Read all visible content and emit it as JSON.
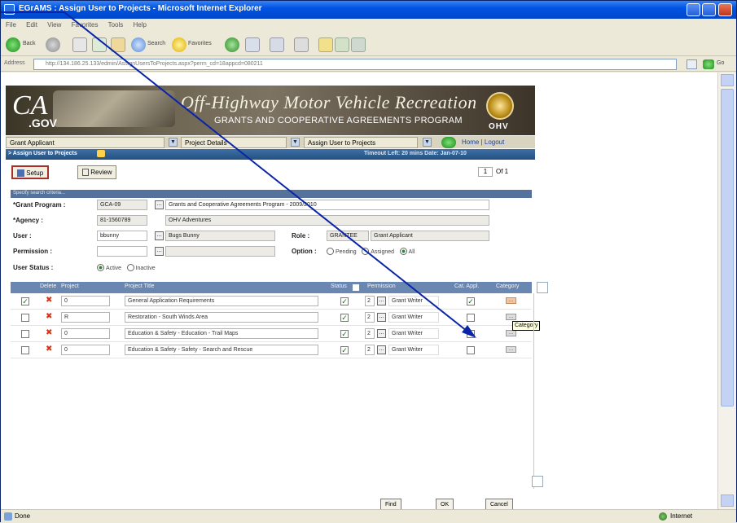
{
  "window": {
    "title": "EGrAMS : Assign User to Projects - Microsoft Internet Explorer"
  },
  "menu": [
    "File",
    "Edit",
    "View",
    "Favorites",
    "Tools",
    "Help"
  ],
  "toolbar": {
    "back": "Back",
    "search": "Search",
    "favorites": "Favorites"
  },
  "address": {
    "label": "Address",
    "url": "http://134.186.25.133/edmin/AssignUsersToProjects.aspx?perm_cd=18appcd=080211",
    "go": "Go"
  },
  "banner": {
    "ca": "CA",
    "gov": ".GOV",
    "title": "Off-Highway Motor Vehicle Recreation",
    "subtitle": "GRANTS AND COOPERATIVE AGREEMENTS PROGRAM",
    "ohv": "OHV"
  },
  "nav": {
    "role": "Grant Applicant",
    "section": "Project Details",
    "page": "Assign User to Projects",
    "home": "Home | Logout"
  },
  "crumb": {
    "title": "> Assign User to Projects",
    "timeout": "Timeout Left: 20 mins  Date: Jan-07-10"
  },
  "tabs": {
    "setup": "Setup",
    "review": "Review",
    "page": "1",
    "of": "Of 1"
  },
  "criteria": {
    "header": "Specify search criteria...",
    "grant_label": "*Grant Program :",
    "grant_code": "GCA-09",
    "grant_name": "Grants and Cooperative Agreements Program - 2009/2010",
    "agency_label": "*Agency :",
    "agency_id": "81-1560789",
    "agency_name": "OHV Adventures",
    "user_label": "User :",
    "user_id": "bbunny",
    "user_name": "Bugs Bunny",
    "role_label": "Role :",
    "role_code": "GRANTEE",
    "role_name": "Grant Applicant",
    "permission_label": "Permission :",
    "option_label": "Option :",
    "opt_pending": "Pending",
    "opt_assigned": "Assigned",
    "opt_all": "All",
    "status_label": "User Status :",
    "st_active": "Active",
    "st_inactive": "Inactive"
  },
  "grid": {
    "headers": {
      "delete": "Delete",
      "project": "Project",
      "title": "Project Title",
      "status": "Status",
      "permission": "Permission",
      "cat_appl": "Cat. Appl.",
      "category": "Category"
    },
    "rows": [
      {
        "project": "0",
        "title": "General Application Requirements",
        "perm": "2",
        "perm_name": "Grant Writer",
        "row_checked": true,
        "cat_checked": true
      },
      {
        "project": "R",
        "title": "Restoration - South Winds Area",
        "perm": "2",
        "perm_name": "Grant Writer",
        "row_checked": false,
        "cat_checked": false
      },
      {
        "project": "0",
        "title": "Education & Safety - Education - Trail Maps",
        "perm": "2",
        "perm_name": "Grant Writer",
        "row_checked": false,
        "cat_checked": false
      },
      {
        "project": "0",
        "title": "Education & Safety - Safety - Search and Rescue",
        "perm": "2",
        "perm_name": "Grant Writer",
        "row_checked": false,
        "cat_checked": false
      }
    ],
    "tooltip": "Category"
  },
  "buttons": {
    "find": "Find",
    "ok": "OK",
    "cancel": "Cancel"
  },
  "status": {
    "left": "Done",
    "right": "Internet"
  }
}
